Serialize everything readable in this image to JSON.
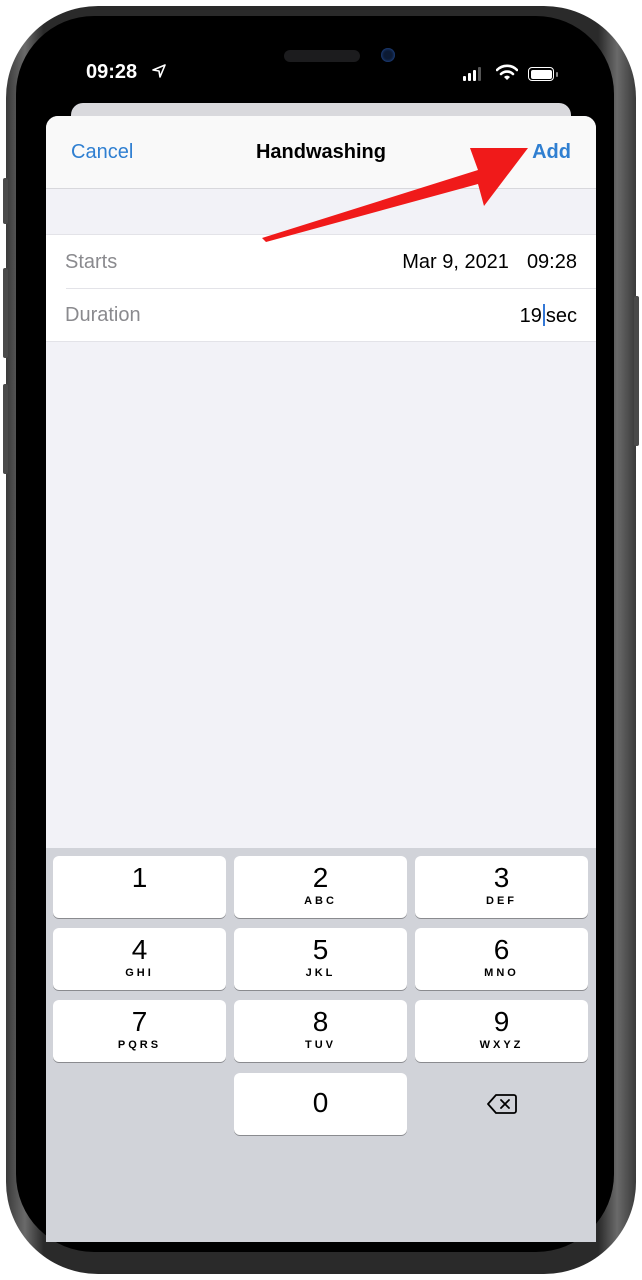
{
  "status_bar": {
    "time": "09:28",
    "location_icon": "location-arrow-icon",
    "signal_icon": "cellular-signal-icon",
    "wifi_icon": "wifi-icon",
    "battery_icon": "battery-icon"
  },
  "navbar": {
    "cancel_label": "Cancel",
    "title": "Handwashing",
    "add_label": "Add"
  },
  "form": {
    "starts": {
      "label": "Starts",
      "date": "Mar 9, 2021",
      "time": "09:28"
    },
    "duration": {
      "label": "Duration",
      "value": "19",
      "unit": "sec"
    }
  },
  "keypad": {
    "keys": [
      {
        "digit": "1",
        "letters": ""
      },
      {
        "digit": "2",
        "letters": "ABC"
      },
      {
        "digit": "3",
        "letters": "DEF"
      },
      {
        "digit": "4",
        "letters": "GHI"
      },
      {
        "digit": "5",
        "letters": "JKL"
      },
      {
        "digit": "6",
        "letters": "MNO"
      },
      {
        "digit": "7",
        "letters": "PQRS"
      },
      {
        "digit": "8",
        "letters": "TUV"
      },
      {
        "digit": "9",
        "letters": "WXYZ"
      },
      {
        "digit": "0",
        "letters": ""
      }
    ],
    "delete_icon": "backspace-icon"
  },
  "annotation": {
    "arrow_color": "#f01a1a",
    "points_to": "Add"
  },
  "colors": {
    "accent": "#2f7fd1",
    "caret": "#3478d6"
  }
}
